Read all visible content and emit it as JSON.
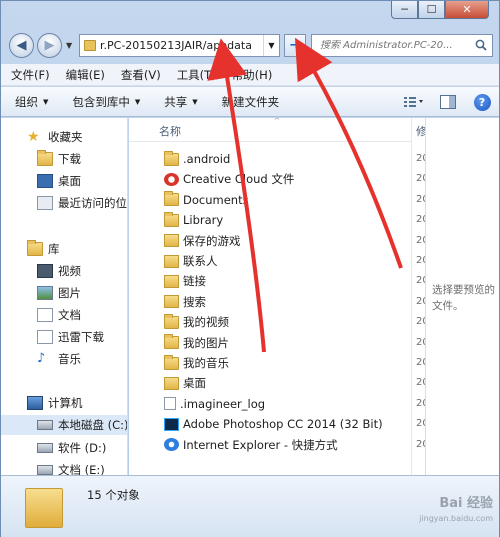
{
  "window": {
    "minimize": "─",
    "maximize": "☐",
    "close": "✕"
  },
  "address": {
    "path": "r.PC-20150213JAIR/appdata",
    "search_placeholder": "搜索 Administrator.PC-20..."
  },
  "menu": [
    "文件(F)",
    "编辑(E)",
    "查看(V)",
    "工具(T)",
    "帮助(H)"
  ],
  "toolbar": {
    "organize": "组织",
    "include": "包含到库中",
    "share": "共享",
    "new_folder": "新建文件夹",
    "help": "?"
  },
  "nav": {
    "favorites": "收藏夹",
    "downloads": "下载",
    "desktop": "桌面",
    "recent": "最近访问的位",
    "libraries": "库",
    "videos": "视频",
    "pictures": "图片",
    "documents": "文档",
    "xunlei": "迅雷下载",
    "music": "音乐",
    "computer": "计算机",
    "local_c": "本地磁盘 (C:)",
    "drive_d": "软件 (D:)",
    "drive_e": "文档 (E:)"
  },
  "columns": {
    "name": "名称",
    "modified": "修",
    "sort": "^"
  },
  "files": [
    {
      "name": ".android",
      "icon": "folder"
    },
    {
      "name": "Creative Cloud 文件",
      "icon": "creative-cloud-icon"
    },
    {
      "name": "Documents",
      "icon": "folder"
    },
    {
      "name": "Library",
      "icon": "folder"
    },
    {
      "name": "保存的游戏",
      "icon": "saved-games-icon"
    },
    {
      "name": "联系人",
      "icon": "contacts-icon"
    },
    {
      "name": "链接",
      "icon": "links-icon"
    },
    {
      "name": "搜索",
      "icon": "searches-icon"
    },
    {
      "name": "我的视频",
      "icon": "folder"
    },
    {
      "name": "我的图片",
      "icon": "folder"
    },
    {
      "name": "我的音乐",
      "icon": "folder"
    },
    {
      "name": "桌面",
      "icon": "desktop-folder-icon"
    },
    {
      "name": ".imagineer_log",
      "icon": "file"
    },
    {
      "name": "Adobe Photoshop CC 2014 (32 Bit)",
      "icon": "photoshop-shortcut-icon"
    },
    {
      "name": "Internet Explorer - 快捷方式",
      "icon": "ie-shortcut-icon"
    }
  ],
  "modified_partial": "20",
  "preview": {
    "message": "选择要预览的文件。"
  },
  "details": {
    "count": "15 个对象"
  },
  "watermark": {
    "line1": "Bai 经验",
    "line2": "jingyan.baidu.com"
  },
  "colors": {
    "arrow": "#e5322d",
    "selection": "#dbe8f7"
  }
}
